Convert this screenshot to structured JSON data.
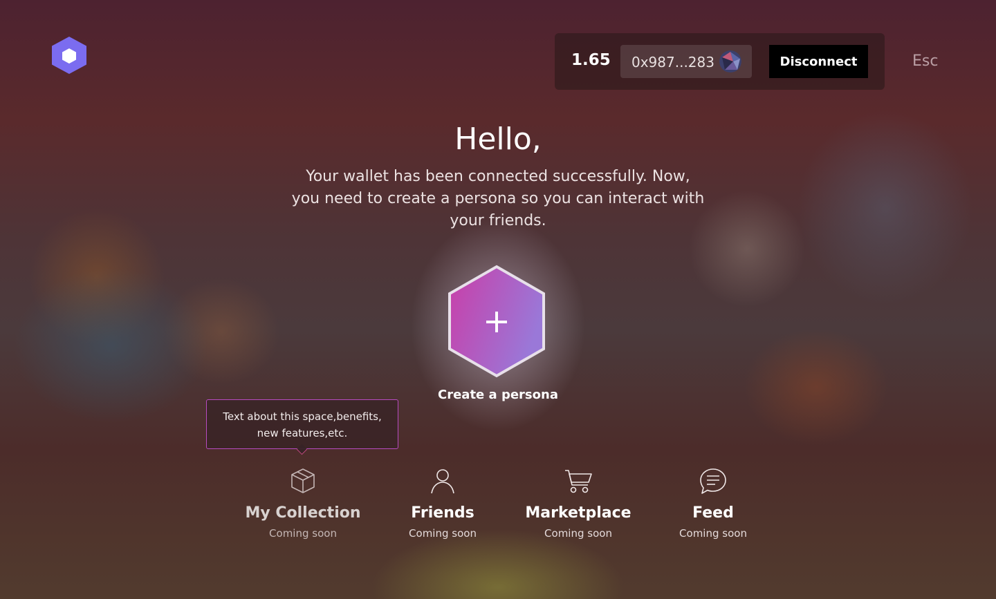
{
  "header": {
    "logo_icon": "hexagon-logo-icon",
    "balance": "1.65",
    "address": "0x987...283",
    "avatar_icon": "wallet-avatar-icon",
    "disconnect_label": "Disconnect",
    "esc_label": "Esc"
  },
  "main": {
    "greeting": "Hello,",
    "message": "Your wallet has been connected successfully. Now, you need to create a persona so you can interact with your friends.",
    "create_persona_label": "Create a persona",
    "create_persona_icon": "plus-icon"
  },
  "tooltip": {
    "text_line1": "Text about this space,benefits,",
    "text_line2": "new features,etc."
  },
  "features": [
    {
      "icon": "box-icon",
      "title": "My Collection",
      "subtitle": "Coming soon"
    },
    {
      "icon": "user-icon",
      "title": "Friends",
      "subtitle": "Coming soon"
    },
    {
      "icon": "cart-icon",
      "title": "Marketplace",
      "subtitle": "Coming soon"
    },
    {
      "icon": "chat-icon",
      "title": "Feed",
      "subtitle": "Coming soon"
    }
  ],
  "colors": {
    "accent": "#7b6cf0",
    "persona_gradient_start": "#c93ea8",
    "persona_gradient_end": "#9a78d8",
    "tooltip_border": "#b84cc2"
  }
}
